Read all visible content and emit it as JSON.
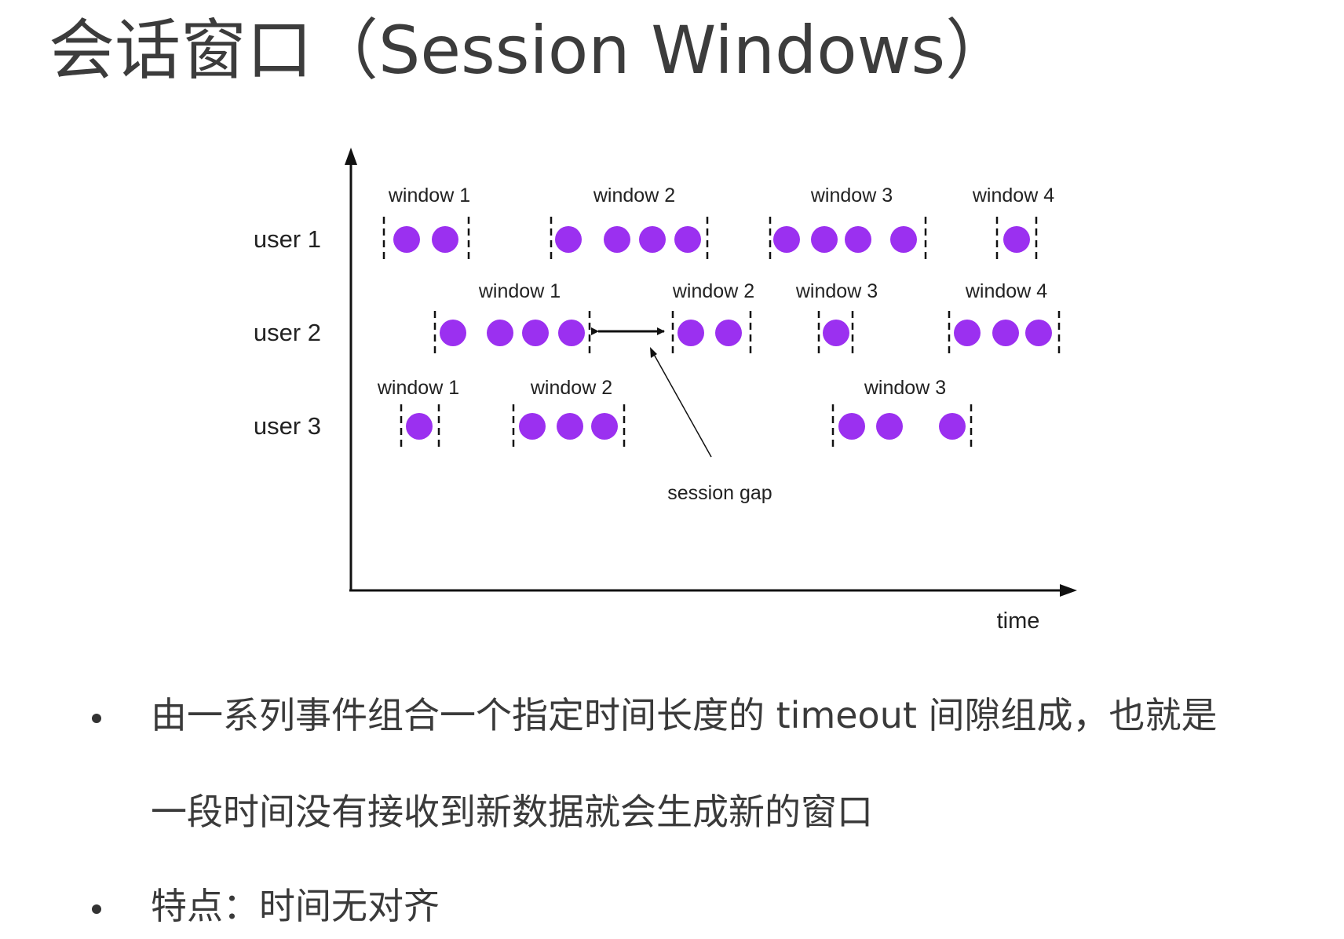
{
  "title": "会话窗口（Session Windows）",
  "diagram": {
    "x_axis_label": "time",
    "session_gap_label": "session gap",
    "colors": {
      "event": "#9b30f0",
      "axis": "#111111",
      "label": "#222222"
    },
    "rows": [
      {
        "user": "user 1",
        "windows": [
          {
            "label": "window 1",
            "events": 2
          },
          {
            "label": "window 2",
            "events": 4
          },
          {
            "label": "window 3",
            "events": 4
          },
          {
            "label": "window 4",
            "events": 1
          }
        ]
      },
      {
        "user": "user 2",
        "windows": [
          {
            "label": "window 1",
            "events": 4
          },
          {
            "label": "window 2",
            "events": 2
          },
          {
            "label": "window 3",
            "events": 1
          },
          {
            "label": "window 4",
            "events": 3
          }
        ]
      },
      {
        "user": "user 3",
        "windows": [
          {
            "label": "window 1",
            "events": 1
          },
          {
            "label": "window 2",
            "events": 3
          },
          {
            "label": "window 3",
            "events": 3
          }
        ]
      }
    ]
  },
  "bullets": [
    {
      "lines": [
        "由一系列事件组合一个指定时间长度的 timeout 间隙组成，也就是",
        "一段时间没有接收到新数据就会生成新的窗口"
      ]
    },
    {
      "lines": [
        "特点：时间无对齐"
      ]
    }
  ]
}
